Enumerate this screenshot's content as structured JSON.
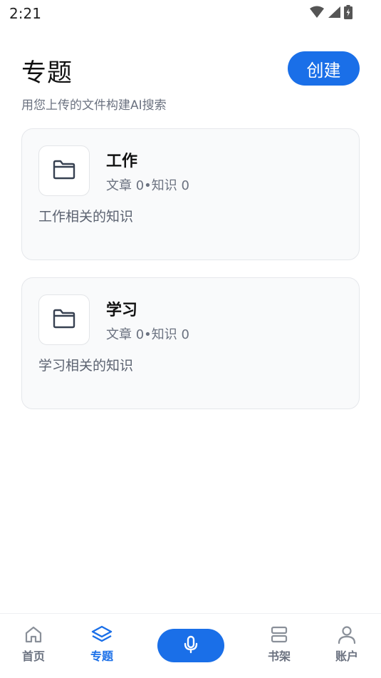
{
  "status_bar": {
    "time": "2:21",
    "icons": [
      "wifi-icon",
      "signal-icon",
      "battery-charging-icon"
    ]
  },
  "header": {
    "title": "专题",
    "subtitle": "用您上传的文件构建AI搜索",
    "create_label": "创建"
  },
  "topics": [
    {
      "name": "工作",
      "stats": "文章 0•知识 0",
      "description": "工作相关的知识",
      "icon": "folder-icon"
    },
    {
      "name": "学习",
      "stats": "文章 0•知识 0",
      "description": "学习相关的知识",
      "icon": "folder-icon"
    }
  ],
  "bottom_nav": {
    "items": [
      {
        "label": "首页",
        "icon": "home-icon",
        "active": false
      },
      {
        "label": "专题",
        "icon": "layers-icon",
        "active": true
      },
      {
        "label": "",
        "icon": "microphone-icon",
        "active": false
      },
      {
        "label": "书架",
        "icon": "bookshelf-icon",
        "active": false
      },
      {
        "label": "账户",
        "icon": "user-icon",
        "active": false
      }
    ]
  },
  "colors": {
    "accent": "#1a6fe8",
    "card_background": "#f9fafb",
    "muted_text": "#6b7280"
  }
}
